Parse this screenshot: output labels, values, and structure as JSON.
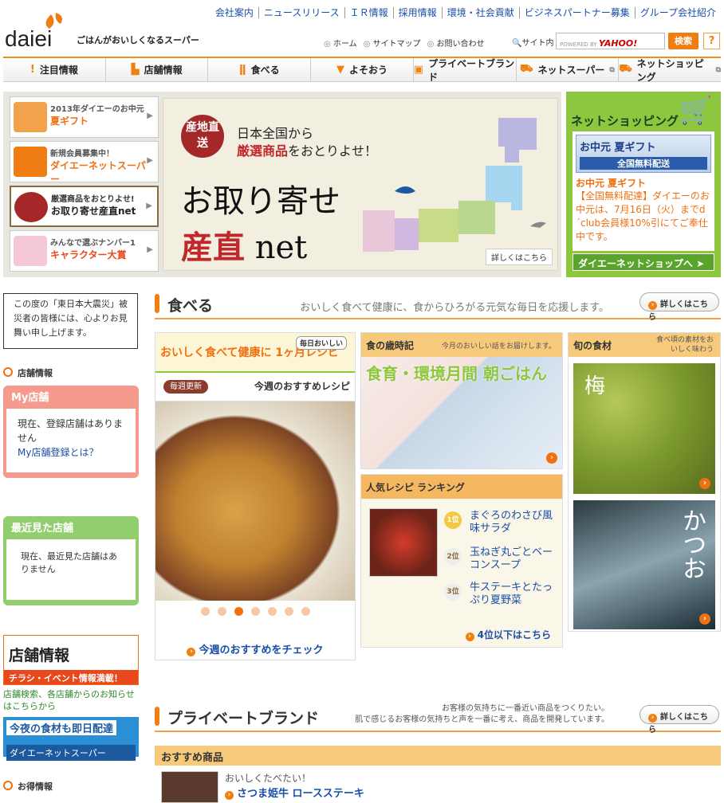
{
  "header": {
    "logo": "daiei",
    "tagline": "ごはんがおいしくなるスーパー",
    "toplinks": [
      "会社案内",
      "ニュースリリース",
      "ＩＲ情報",
      "採用情報",
      "環境・社会貢献",
      "ビジネスパートナー募集",
      "グループ会社紹介"
    ],
    "sublinks": [
      "ホーム",
      "サイトマップ",
      "お問い合わせ"
    ],
    "site_search_label": "サイト内",
    "search_powered": "POWERED BY",
    "search_brand": "YAHOO!",
    "search_btn": "検索",
    "help": "?"
  },
  "nav": [
    {
      "label": "注目情報",
      "icon": "exclamation-icon"
    },
    {
      "label": "店舗情報",
      "icon": "store-icon"
    },
    {
      "label": "食べる",
      "icon": "utensils-icon"
    },
    {
      "label": "よそおう",
      "icon": "shirt-icon"
    },
    {
      "label": "プライベートブランド",
      "icon": "bag-icon"
    },
    {
      "label": "ネットスーパー",
      "icon": "cart-icon"
    },
    {
      "label": "ネットショッピング",
      "icon": "truck-icon"
    }
  ],
  "hero": {
    "banners": [
      {
        "line1": "2013年ダイエーのお中元",
        "line2": "夏ギフト"
      },
      {
        "line1": "新規会員募集中！",
        "line2": "ダイエーネットスーパー"
      },
      {
        "line1": "厳選商品をおとりよせ!",
        "line2": "お取り寄せ産直net"
      },
      {
        "line1": "みんなで選ぶナンバー1",
        "line2": "キャラクター大賞"
      }
    ],
    "seal": "産地直送",
    "headline1": "日本全国から",
    "headline2_a": "厳選商品",
    "headline2_b": "をおとりよせ！",
    "title1": "お取り寄せ",
    "title2_a": "産直",
    "title2_b": "net",
    "details": "詳しくはこちら"
  },
  "netshop": {
    "title": "ネットショッピング",
    "banner_label": "お中元 夏ギフト",
    "banner_sub": "全国無料配送",
    "item_title": "お中元 夏ギフト",
    "item_text": "【全国無料配達】ダイエーのお中元は、7月16日（火）までd´club会員様10%引にてご奉仕中です。",
    "button": "ダイエーネットショップへ"
  },
  "left": {
    "quake": "この度の「東日本大震災」被災者の皆様には、心よりお見舞い申し上げます。",
    "store_info_head": "店舗情報",
    "mystore_title": "My店舗",
    "mystore_text": "現在、登録店舗はありません",
    "mystore_link": "My店舗登録とは？",
    "recent_title": "最近見た店舗",
    "recent_text": "現在、最近見た店舗はありません",
    "tenpo_banner": "店舗情報",
    "tenpo_banner_sub": "チラシ・イベント情報満載！",
    "tenpo_link": "店舗検索、各店舗からのお知らせはこちらから",
    "night_banner": "今夜の食材も即日配達",
    "night_banner_sub": "ダイエーネットスーパー",
    "otoku_head": "お得情報"
  },
  "taberu": {
    "title": "食べる",
    "desc": "おいしく食べて健康に、食からひろがる元気な毎日を応援します。",
    "btn": "詳しくはこちら",
    "recipe_head": "おいしく食べて健康に 1ヶ月レシピ",
    "recipe_tag": "毎日おいしい",
    "weekly_badge": "毎週更新",
    "weekly_title": "今週のおすすめレシピ",
    "recipe_link": "今週のおすすめをチェック",
    "slide_count": 7,
    "slide_active": 3,
    "saijiki_title": "食の歳時記",
    "saijiki_sub": "今月のおいしい話をお届けします。",
    "saijiki_img_text": "食育・環境月間 朝ごはん",
    "ranking_title": "人気レシピ ランキング",
    "ranking": [
      {
        "rank": "1位",
        "name": "まぐろのわさび風味サラダ"
      },
      {
        "rank": "2位",
        "name": "玉ねぎ丸ごとベーコンスープ"
      },
      {
        "rank": "3位",
        "name": "牛ステーキとたっぷり夏野菜"
      }
    ],
    "ranking_more": "4位以下はこちら",
    "shun_title": "旬の食材",
    "shun_sub": "食べ頃の素材をおいしく味わう",
    "shun1": "梅",
    "shun2": "かつお"
  },
  "pb": {
    "title": "プライベートブランド",
    "desc1": "お客様の気持ちに一番近い商品をつくりたい。",
    "desc2": "肌で感じるお客様の気持ちと声を一番に考え、商品を開発しています。",
    "btn": "詳しくはこちら",
    "osusume": "おすすめ商品",
    "prod_catch": "おいしくたべたい！",
    "prod_name": "さつま姫牛 ロースステーキ"
  }
}
